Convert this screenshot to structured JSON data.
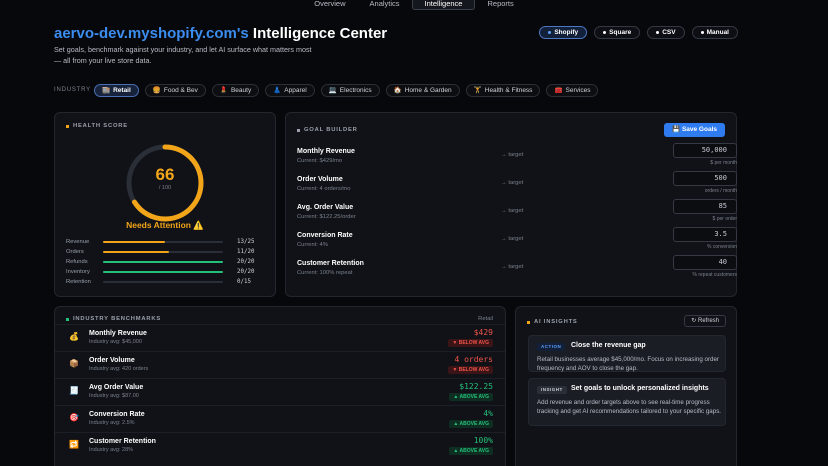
{
  "nav": {
    "tabs": [
      "Overview",
      "Analytics",
      "Intelligence",
      "Reports"
    ],
    "active": 2
  },
  "header": {
    "store": "aervo-dev.myshopify.com's",
    "title_rest": " Intelligence Center",
    "subtitle": "Set goals, benchmark against your industry, and let AI surface what matters most — all from your live store data."
  },
  "pos": [
    {
      "label": "Shopify",
      "active": true
    },
    {
      "label": "Square",
      "active": false
    },
    {
      "label": "CSV",
      "active": false
    },
    {
      "label": "Manual",
      "active": false
    }
  ],
  "industry": {
    "label": "INDUSTRY",
    "items": [
      {
        "icon": "🏬",
        "label": "Retail",
        "active": true
      },
      {
        "icon": "🍔",
        "label": "Food & Bev",
        "active": false
      },
      {
        "icon": "💄",
        "label": "Beauty",
        "active": false
      },
      {
        "icon": "👗",
        "label": "Apparel",
        "active": false
      },
      {
        "icon": "💻",
        "label": "Electronics",
        "active": false
      },
      {
        "icon": "🏠",
        "label": "Home & Garden",
        "active": false
      },
      {
        "icon": "🏋",
        "label": "Health & Fitness",
        "active": false
      },
      {
        "icon": "🧰",
        "label": "Services",
        "active": false
      }
    ]
  },
  "health": {
    "heading": "HEALTH SCORE",
    "score": "66",
    "score_of": "/ 100",
    "score_fraction": 0.66,
    "status": "Needs Attention ⚠️",
    "color": "#f3a51a",
    "rows": [
      {
        "label": "Revenue",
        "value": "13/25",
        "fraction": 0.52,
        "color": "#f3a51a"
      },
      {
        "label": "Orders",
        "value": "11/20",
        "fraction": 0.55,
        "color": "#f3a51a"
      },
      {
        "label": "Refunds",
        "value": "20/20",
        "fraction": 1.0,
        "color": "#23c07a"
      },
      {
        "label": "Inventory",
        "value": "20/20",
        "fraction": 1.0,
        "color": "#23c07a"
      },
      {
        "label": "Retention",
        "value": "0/15",
        "fraction": 0.0,
        "color": "#23c07a"
      }
    ]
  },
  "goals": {
    "heading": "GOAL BUILDER",
    "save_label": "💾 Save Goals",
    "items": [
      {
        "name": "Monthly Revenue",
        "current": "Current: $429/mo",
        "arrow": "→ target",
        "value": "50,000",
        "unit": "$ per month"
      },
      {
        "name": "Order Volume",
        "current": "Current: 4 orders/mo",
        "arrow": "→ target",
        "value": "500",
        "unit": "orders / month"
      },
      {
        "name": "Avg. Order Value",
        "current": "Current: $122.25/order",
        "arrow": "→ target",
        "value": "85",
        "unit": "$ per order"
      },
      {
        "name": "Conversion Rate",
        "current": "Current: 4%",
        "arrow": "→ target",
        "value": "3.5",
        "unit": "% conversion"
      },
      {
        "name": "Customer Retention",
        "current": "Current: 100% repeat",
        "arrow": "→ target",
        "value": "40",
        "unit": "% repeat customers"
      }
    ]
  },
  "benchmarks": {
    "heading": "INDUSTRY BENCHMARKS",
    "industry": "Retail",
    "rows": [
      {
        "icon": "💰",
        "name": "Monthly Revenue",
        "avg": "Industry avg: $45,000",
        "value": "$429",
        "badge": "▼ BELOW AVG",
        "status": "below"
      },
      {
        "icon": "📦",
        "name": "Order Volume",
        "avg": "Industry avg: 420 orders",
        "value": "4 orders",
        "badge": "▼ BELOW AVG",
        "status": "below"
      },
      {
        "icon": "🧾",
        "name": "Avg Order Value",
        "avg": "Industry avg: $87.00",
        "value": "$122.25",
        "badge": "▲ ABOVE AVG",
        "status": "above"
      },
      {
        "icon": "🎯",
        "name": "Conversion Rate",
        "avg": "Industry avg: 2.5%",
        "value": "4%",
        "badge": "▲ ABOVE AVG",
        "status": "above"
      },
      {
        "icon": "🔁",
        "name": "Customer Retention",
        "avg": "Industry avg: 28%",
        "value": "100%",
        "badge": "▲ ABOVE AVG",
        "status": "above"
      }
    ]
  },
  "insights": {
    "heading": "AI INSIGHTS",
    "refresh_label": "↻ Refresh",
    "cards": [
      {
        "tag": "ACTION",
        "title": "Close the revenue gap",
        "text": "Retail businesses average $45,000/mo. Focus on increasing order frequency and AOV to close the gap."
      },
      {
        "tag": "INSIGHT",
        "title": "Set goals to unlock personalized insights",
        "text": "Add revenue and order targets above to see real-time progress tracking and get AI recommendations tailored to your specific gaps."
      }
    ]
  }
}
